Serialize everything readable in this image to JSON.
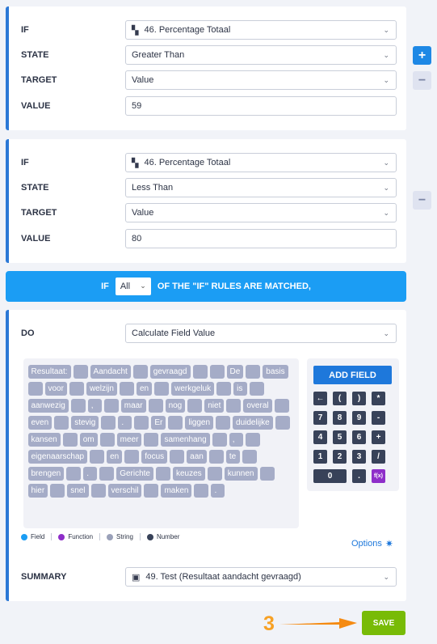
{
  "conditions": [
    {
      "if_label": "IF",
      "if_value": "46. Percentage Totaal",
      "state_label": "STATE",
      "state_value": "Greater Than",
      "target_label": "TARGET",
      "target_value": "Value",
      "value_label": "VALUE",
      "value_value": "59"
    },
    {
      "if_label": "IF",
      "if_value": "46. Percentage Totaal",
      "state_label": "STATE",
      "state_value": "Less Than",
      "target_label": "TARGET",
      "target_value": "Value",
      "value_label": "VALUE",
      "value_value": "80"
    }
  ],
  "side_buttons": {
    "add": "+",
    "remove": "−"
  },
  "if_bar": {
    "prefix": "IF",
    "selected": "All",
    "suffix": "OF THE \"IF\" RULES ARE MATCHED,"
  },
  "action": {
    "do_label": "DO",
    "do_value": "Calculate Field Value",
    "tokens": [
      "Resultaat:",
      "",
      "Aandacht",
      "",
      "gevraagd",
      "",
      "",
      "De",
      "",
      "basis",
      "",
      "voor",
      "",
      "welzijn",
      "",
      "en",
      "",
      "werkgeluk",
      "",
      "is",
      "",
      "aanwezig",
      "",
      ",",
      "",
      "maar",
      "",
      "nog",
      "",
      "niet",
      "",
      "overal",
      "",
      "even",
      "",
      "stevig",
      "",
      ".",
      "",
      "Er",
      "",
      "liggen",
      "",
      "duidelijke",
      "",
      "kansen",
      "",
      "om",
      "",
      "meer",
      "",
      "samenhang",
      "",
      ",",
      "",
      "eigenaarschap",
      "",
      "en",
      "",
      "focus",
      "",
      "aan",
      "",
      "te",
      "",
      "brengen",
      "",
      ".",
      "",
      "Gerichte",
      "",
      "keuzes",
      "",
      "kunnen",
      "",
      "hier",
      "",
      "snel",
      "",
      "verschil",
      "",
      "maken",
      "",
      "."
    ],
    "add_field_label": "ADD FIELD",
    "keypad": [
      "←",
      "(",
      ")",
      "*",
      "7",
      "8",
      "9",
      "-",
      "4",
      "5",
      "6",
      "+",
      "1",
      "2",
      "3",
      "/",
      "0",
      ".",
      "f(x)"
    ],
    "legend": [
      {
        "label": "Field",
        "color": "#1b9df4"
      },
      {
        "label": "Function",
        "color": "#8e2ec9"
      },
      {
        "label": "String",
        "color": "#9aa1b9"
      },
      {
        "label": "Number",
        "color": "#384259"
      }
    ],
    "options_label": "Options",
    "summary_label": "SUMMARY",
    "summary_value": "49. Test (Resultaat aandacht gevraagd)"
  },
  "save_label": "SAVE",
  "step_number": "3",
  "colors": {
    "accent": "#1e88e5",
    "bar": "#1b9df4",
    "save": "#78bb07",
    "step": "#f7a125"
  }
}
